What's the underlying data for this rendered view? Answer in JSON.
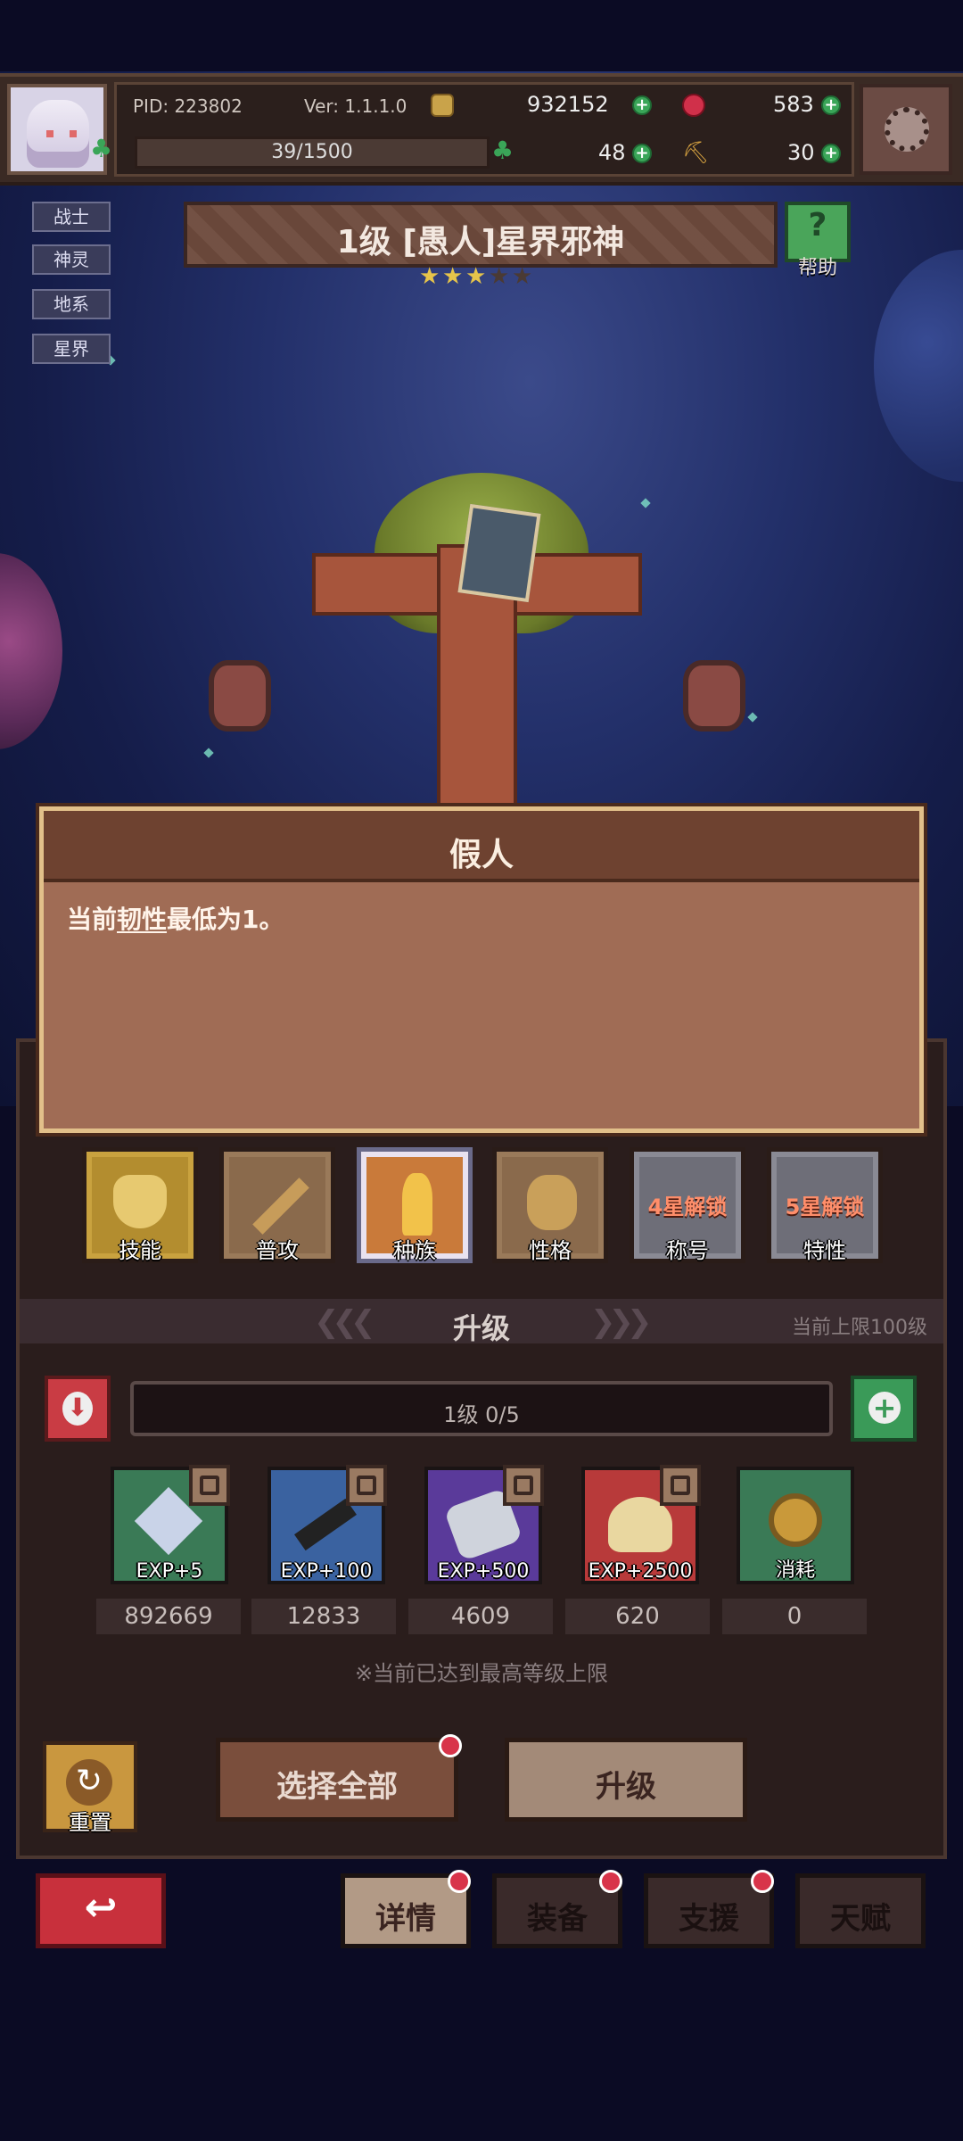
{
  "player": {
    "pid": "PID: 223802",
    "version": "Ver: 1.1.1.0",
    "gold": "932152",
    "gems": "583",
    "xp": "39/1500",
    "clover": "48",
    "shovel": "30"
  },
  "tags": [
    "战士",
    "神灵",
    "地系",
    "星界"
  ],
  "character": {
    "title": "1级 [愚人]星界邪神",
    "stars_filled": 3,
    "stars_total": 5
  },
  "help_label": "帮助",
  "tooltip": {
    "title": "假人",
    "text_before": "当前",
    "text_keyword": "韧性",
    "text_after": "最低为1。"
  },
  "slots": [
    {
      "label": "技能"
    },
    {
      "label": "普攻"
    },
    {
      "label": "种族"
    },
    {
      "label": "性格"
    },
    {
      "label": "称号",
      "lock": "4星解锁"
    },
    {
      "label": "特性",
      "lock": "5星解锁"
    }
  ],
  "upgrade": {
    "header": "升级",
    "cap": "当前上限100级",
    "level_text": "1级  0/5",
    "items": [
      {
        "exp": "EXP+5",
        "count": "892669"
      },
      {
        "exp": "EXP+100",
        "count": "12833"
      },
      {
        "exp": "EXP+500",
        "count": "4609"
      },
      {
        "exp": "EXP+2500",
        "count": "620"
      },
      {
        "exp": "消耗",
        "count": "0"
      }
    ],
    "max_note": "※当前已达到最高等级上限",
    "reset_label": "重置",
    "select_all": "选择全部",
    "upgrade_btn": "升级"
  },
  "nav": {
    "details": "详情",
    "equip": "装备",
    "support": "支援",
    "talent": "天赋"
  },
  "colors": {
    "accent_green": "#3aa558",
    "accent_red": "#c8303c",
    "panel": "#2a1d1c",
    "tooltip_bg": "#a06c55"
  }
}
